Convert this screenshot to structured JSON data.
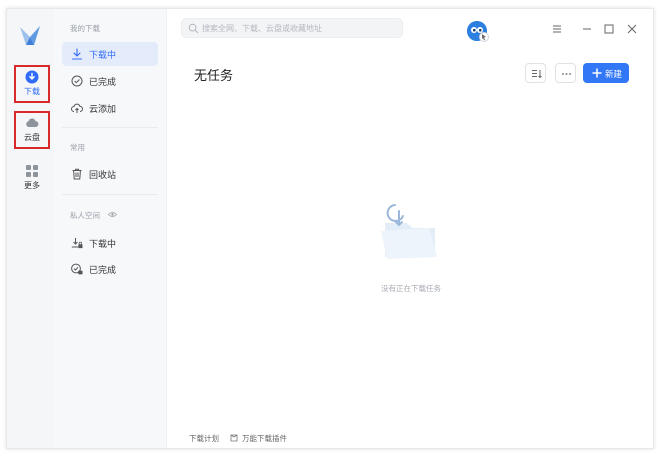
{
  "rail": {
    "items": [
      {
        "label": "下载",
        "icon": "download-icon",
        "active": true
      },
      {
        "label": "云盘",
        "icon": "cloud-icon",
        "active": false
      },
      {
        "label": "更多",
        "icon": "more-apps-icon",
        "active": false
      }
    ]
  },
  "sidebar": {
    "group_downloads": "我的下载",
    "downloads": [
      {
        "label": "下载中",
        "icon": "download-arrow-icon",
        "active": true
      },
      {
        "label": "已完成",
        "icon": "check-circle-icon",
        "active": false
      },
      {
        "label": "云添加",
        "icon": "cloud-upload-icon",
        "active": false
      }
    ],
    "group_common": "常用",
    "common": [
      {
        "label": "回收站",
        "icon": "trash-icon",
        "active": false
      }
    ],
    "group_private": "私人空间",
    "private": [
      {
        "label": "下载中",
        "icon": "lock-download-icon",
        "active": false
      },
      {
        "label": "已完成",
        "icon": "lock-check-icon",
        "active": false
      }
    ]
  },
  "topbar": {
    "search_placeholder": "搜索全网、下载、云盘或收藏地址",
    "search_value": ""
  },
  "main": {
    "title": "无任务",
    "new_button_label": "新建",
    "empty_text": "没有正在下载任务"
  },
  "footer": {
    "plan_label": "下载计划",
    "plugin_label": "万能下载插件"
  },
  "colors": {
    "accent": "#3278f6",
    "highlight_border": "#d9292b",
    "sidebar_bg": "#f7f8fa"
  }
}
